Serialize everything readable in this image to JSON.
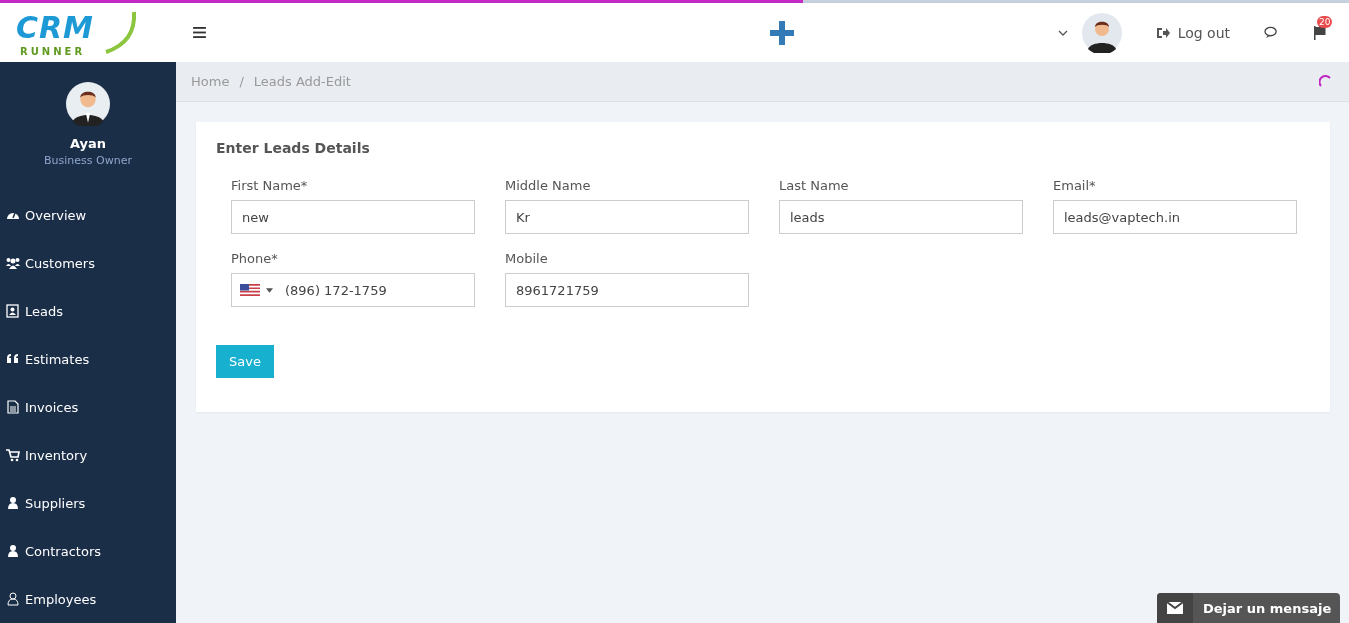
{
  "loading_bar": {
    "level": 0.595
  },
  "logo": {
    "word": "CRM",
    "tagline": "RUNNER"
  },
  "header": {
    "logout": "Log out",
    "notifications_count": "20"
  },
  "user": {
    "name": "Ayan",
    "role": "Business Owner"
  },
  "sidebar": {
    "items": [
      {
        "label": "Overview"
      },
      {
        "label": "Customers"
      },
      {
        "label": "Leads"
      },
      {
        "label": "Estimates"
      },
      {
        "label": "Invoices"
      },
      {
        "label": "Inventory"
      },
      {
        "label": "Suppliers"
      },
      {
        "label": "Contractors"
      },
      {
        "label": "Employees"
      }
    ]
  },
  "breadcrumb": {
    "items": [
      "Home",
      "Leads Add-Edit"
    ],
    "separator": "/"
  },
  "form": {
    "title": "Enter Leads Details",
    "fields": [
      {
        "label": "First Name*",
        "value": "new",
        "kind": "text"
      },
      {
        "label": "Middle Name",
        "value": "Kr",
        "kind": "text"
      },
      {
        "label": "Last Name",
        "value": "leads",
        "kind": "text"
      },
      {
        "label": "Email*",
        "value": "leads@vaptech.in",
        "kind": "text"
      },
      {
        "label": "Phone*",
        "value": "(896) 172-1759",
        "kind": "phone"
      },
      {
        "label": "Mobile",
        "value": "8961721759",
        "kind": "text"
      }
    ],
    "save": "Save"
  },
  "chat_widget": {
    "label": "Dejar un mensaje"
  }
}
